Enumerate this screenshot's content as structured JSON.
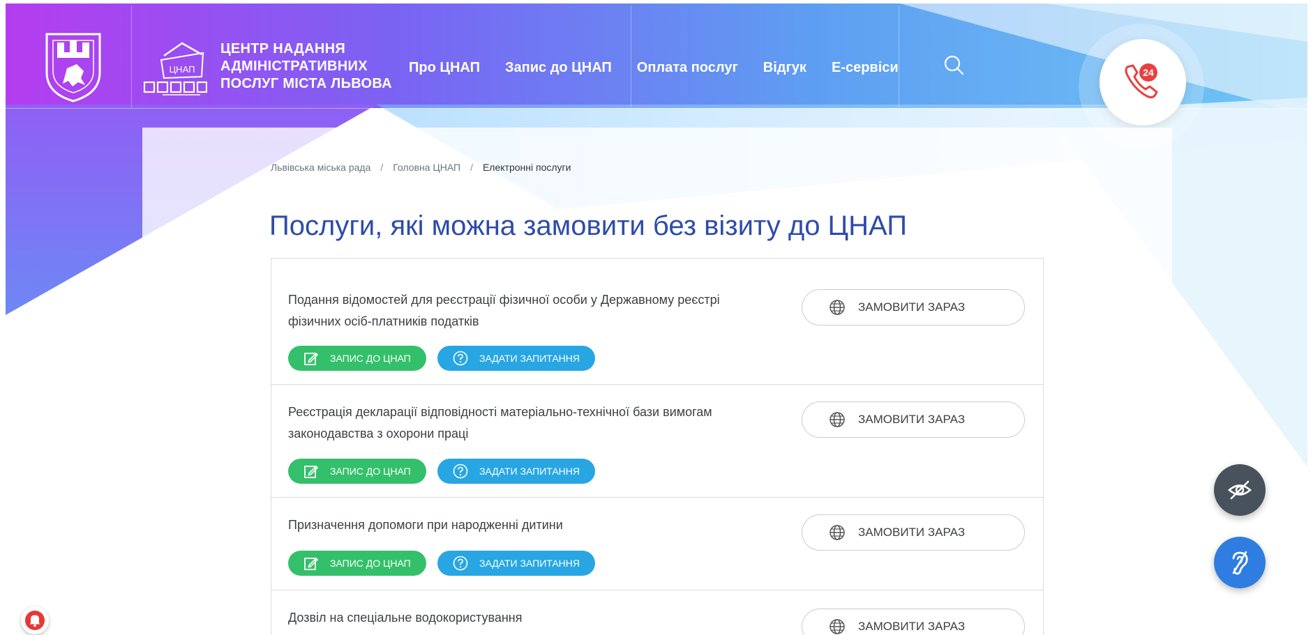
{
  "header": {
    "logo_lines": [
      "ЦЕНТР  НАДАННЯ",
      "АДМІНІСТРАТИВНИХ",
      "ПОСЛУГ  МІСТА ЛЬВОВА"
    ],
    "logo_mark_label": "ЦНАП",
    "nav": [
      "Про ЦНАП",
      "Запис до ЦНАП",
      "Оплата послуг",
      "Відгук",
      "Е-сервіси"
    ],
    "phone_badge": "24"
  },
  "breadcrumb": [
    "Львівська міська рада",
    "Головна ЦНАП",
    "Електронні послуги"
  ],
  "breadcrumb_separator": "/",
  "page_title": "Послуги, які можна замовити без візиту до ЦНАП",
  "services": [
    {
      "title": "Подання відомостей для реєстрації фізичної особи у Державному реєстрі фізичних осіб-платників податків"
    },
    {
      "title": "Реєстрація декларації відповідності матеріально-технічної бази вимогам законодавства з охорони праці"
    },
    {
      "title": "Призначення допомоги при народженні дитини"
    },
    {
      "title": "Дозвіл на спеціальне водокористування"
    }
  ],
  "labels": {
    "order_now": "ЗАМОВИТИ ЗАРАЗ",
    "appointment": "ЗАПИС ДО ЦНАП",
    "ask_question": "ЗАДАТИ ЗАПИТАННЯ"
  },
  "colors": {
    "title_blue": "#2e4ca8",
    "chip_green": "#34c06a",
    "chip_blue": "#27a6e3",
    "phone_red": "#e8403f",
    "accessibility_dark": "#47525c",
    "accessibility_blue": "#2f7de1",
    "notification_red": "#e53935"
  },
  "icons": [
    "crest-icon",
    "cnap-logo-icon",
    "search-icon",
    "phone-24-icon",
    "globe-icon",
    "edit-icon",
    "question-icon",
    "eye-off-icon",
    "ear-off-icon",
    "bell-icon"
  ]
}
